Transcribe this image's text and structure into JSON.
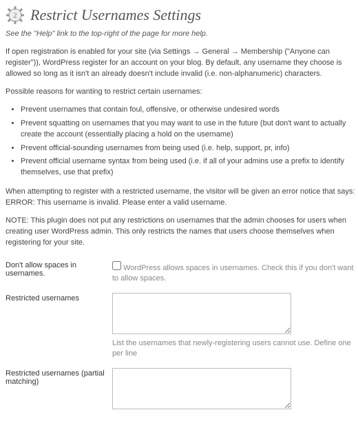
{
  "header": {
    "title": "Restrict Usernames Settings",
    "gear_num": "2"
  },
  "help_note": "See the \"Help\" link to the top-right of the page for more help.",
  "intro": "If open registration is enabled for your site (via Settings → General → Membership (\"Anyone can register\")), WordPress register for an account on your blog. By default, any username they choose is allowed so long as it isn't an already doesn't include invalid (i.e. non-alphanumeric) characters.",
  "reasons_heading": "Possible reasons for wanting to restrict certain usernames:",
  "reasons": [
    "Prevent usernames that contain foul, offensive, or otherwise undesired words",
    "Prevent squatting on usernames that you may want to use in the future (but don't want to actually create the account (essentially placing a hold on the username)",
    "Prevent official-sounding usernames from being used (i.e. help, support, pr, info)",
    "Prevent official username syntax from being used (i.e. if all of your admins use a prefix to identify themselves, use that prefix)"
  ],
  "error_intro": "When attempting to register with a restricted username, the visitor will be given an error notice that says:",
  "error_msg": "ERROR: This username is invalid. Please enter a valid username.",
  "note": "NOTE: This plugin does not put any restrictions on usernames that the admin chooses for users when creating user WordPress admin. This only restricts the names that users choose themselves when registering for your site.",
  "fields": {
    "spaces": {
      "label": "Don't allow spaces in usernames.",
      "desc": "WordPress allows spaces in usernames. Check this if you don't want to allow spaces."
    },
    "restricted": {
      "label": "Restricted usernames",
      "value": "",
      "desc": "List the usernames that newly-registering users cannot use. Define one per line"
    },
    "partial": {
      "label": "Restricted usernames (partial matching)",
      "value": ""
    }
  }
}
